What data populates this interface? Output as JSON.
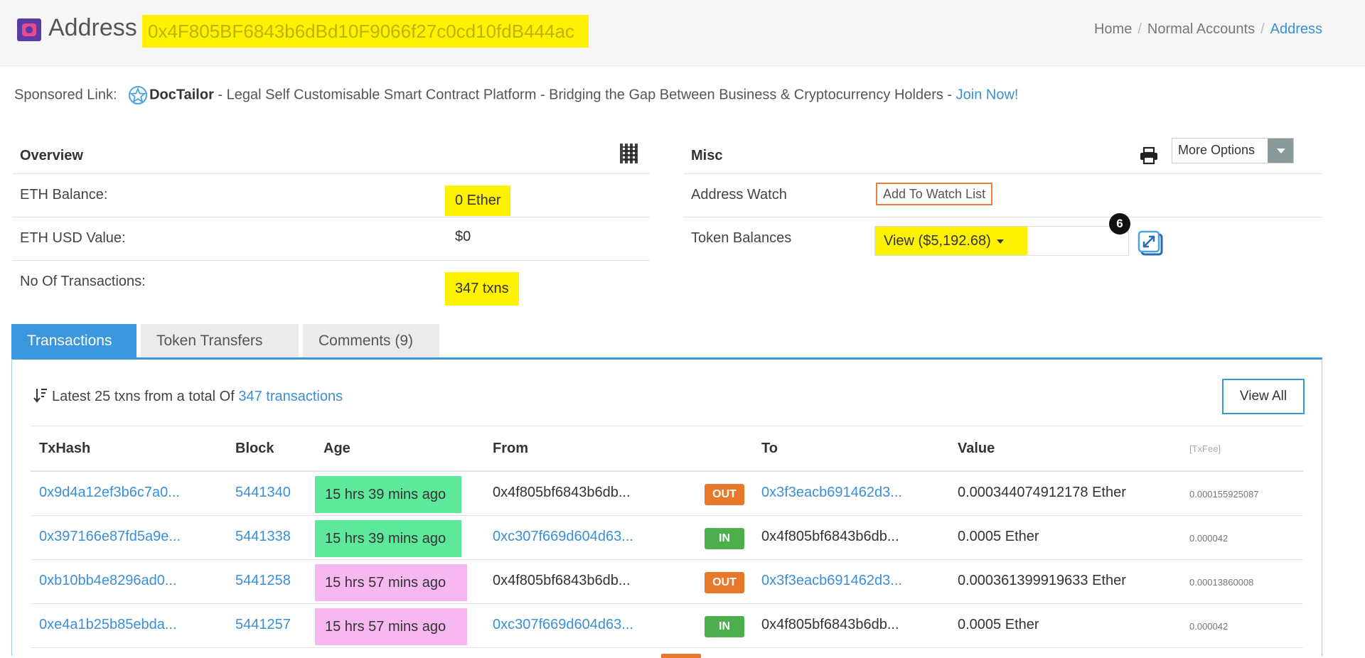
{
  "header": {
    "title": "Address",
    "address": "0x4F805BF6843b6dBd10F9066f27c0cd10fdB444ac",
    "breadcrumb": [
      "Home",
      "Normal Accounts",
      "Address"
    ]
  },
  "sponsor": {
    "prefix": "Sponsored Link:",
    "brand": "DocTailor",
    "text": " - Legal Self Customisable Smart Contract Platform - Bridging the Gap Between Business & Cryptocurrency Holders - ",
    "cta": "Join Now!"
  },
  "overview": {
    "title": "Overview",
    "rows": [
      {
        "label": "ETH Balance:",
        "value": "0 Ether"
      },
      {
        "label": "ETH USD Value:",
        "value": "$0"
      },
      {
        "label": "No Of Transactions:",
        "value": "347 txns"
      }
    ]
  },
  "misc": {
    "title": "Misc",
    "more_options": "More Options",
    "address_watch_label": "Address Watch",
    "add_watch": "Add To Watch List",
    "token_balances_label": "Token Balances",
    "token_view": "View ($5,192.68)",
    "token_count": "6"
  },
  "tabs": [
    "Transactions",
    "Token Transfers",
    "Comments (9)"
  ],
  "txlist": {
    "summary_prefix": "Latest 25 txns from a total Of ",
    "summary_link": "347 transactions",
    "view_all": "View All",
    "columns": [
      "TxHash",
      "Block",
      "Age",
      "From",
      "To",
      "Value",
      "[TxFee]"
    ],
    "rows": [
      {
        "hash": "0x9d4a12ef3b6c7a0...",
        "block": "5441340",
        "age": "15 hrs 39 mins ago",
        "from": "0x4f805bf6843b6db...",
        "dir": "OUT",
        "to": "0x3f3eacb691462d3...",
        "value": "0.000344074912178 Ether",
        "fee": "0.000155925087"
      },
      {
        "hash": "0x397166e87fd5a9e...",
        "block": "5441338",
        "age": "15 hrs 39 mins ago",
        "from": "0xc307f669d604d63...",
        "dir": "IN",
        "to": "0x4f805bf6843b6db...",
        "value": "0.0005 Ether",
        "fee": "0.000042"
      },
      {
        "hash": "0xb10bb4e8296ad0...",
        "block": "5441258",
        "age": "15 hrs 57 mins ago",
        "from": "0x4f805bf6843b6db...",
        "dir": "OUT",
        "to": "0x3f3eacb691462d3...",
        "value": "0.000361399919633 Ether",
        "fee": "0.00013860008"
      },
      {
        "hash": "0xe4a1b25b85ebda...",
        "block": "5441257",
        "age": "15 hrs 57 mins ago",
        "from": "0xc307f669d604d63...",
        "dir": "IN",
        "to": "0x4f805bf6843b6db...",
        "value": "0.0005 Ether",
        "fee": "0.000042"
      }
    ]
  },
  "colors": {
    "accent": "#3b97dd",
    "highlight_yellow": "#fff200",
    "age_green": "#5ee89c",
    "age_pink": "#f7b8f1",
    "out_badge": "#e8792b",
    "in_badge": "#4cae4c"
  },
  "icons": [
    "address-logo-icon",
    "doctailor-star-icon",
    "qr-code-icon",
    "print-icon",
    "chevron-down-icon",
    "expand-icon",
    "sort-icon"
  ]
}
